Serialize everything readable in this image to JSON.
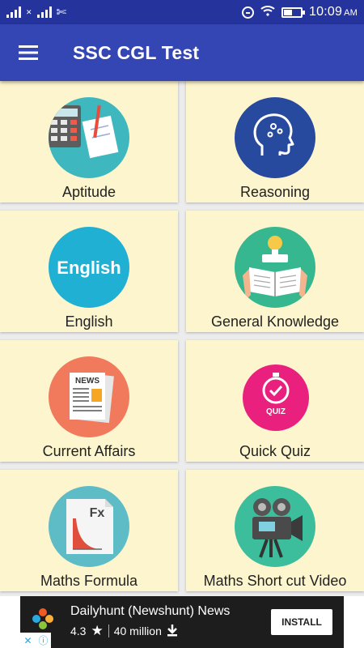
{
  "status_bar": {
    "time": "10:09",
    "ampm": "AM"
  },
  "app_bar": {
    "title": "SSC CGL Test",
    "menu_icon": "hamburger-menu-icon"
  },
  "categories": [
    {
      "label": "Aptitude",
      "icon": "calculator-icon",
      "circle_color": "#3fb7bf"
    },
    {
      "label": "Reasoning",
      "icon": "brain-head-icon",
      "circle_color": "#27499e"
    },
    {
      "label": "English",
      "icon": "english-text-icon",
      "icon_text": "English",
      "circle_color": "#1fb0d4"
    },
    {
      "label": "General Knowledge",
      "icon": "book-lightbulb-icon",
      "circle_color": "#36b78f"
    },
    {
      "label": "Current Affairs",
      "icon": "newspaper-icon",
      "icon_text": "NEWS",
      "circle_color": "#f27a5c"
    },
    {
      "label": "Quick Quiz",
      "icon": "quiz-stopwatch-icon",
      "icon_text": "QUIZ",
      "circle_color": "#e9207e"
    },
    {
      "label": "Maths Formula",
      "icon": "formula-document-icon",
      "icon_text": "Fx",
      "circle_color": "#5dbcc6"
    },
    {
      "label": "Maths Short cut Video",
      "icon": "video-camera-icon",
      "circle_color": "#3cbd9c"
    }
  ],
  "ad": {
    "title": "Dailyhunt (Newshunt) News",
    "rating": "4.3",
    "downloads": "40 million",
    "install_label": "INSTALL"
  },
  "colors": {
    "status_bar": "#25339c",
    "app_bar": "#3445b4",
    "card_background": "#fdf5cd",
    "ad_background": "#1d1d1d"
  }
}
